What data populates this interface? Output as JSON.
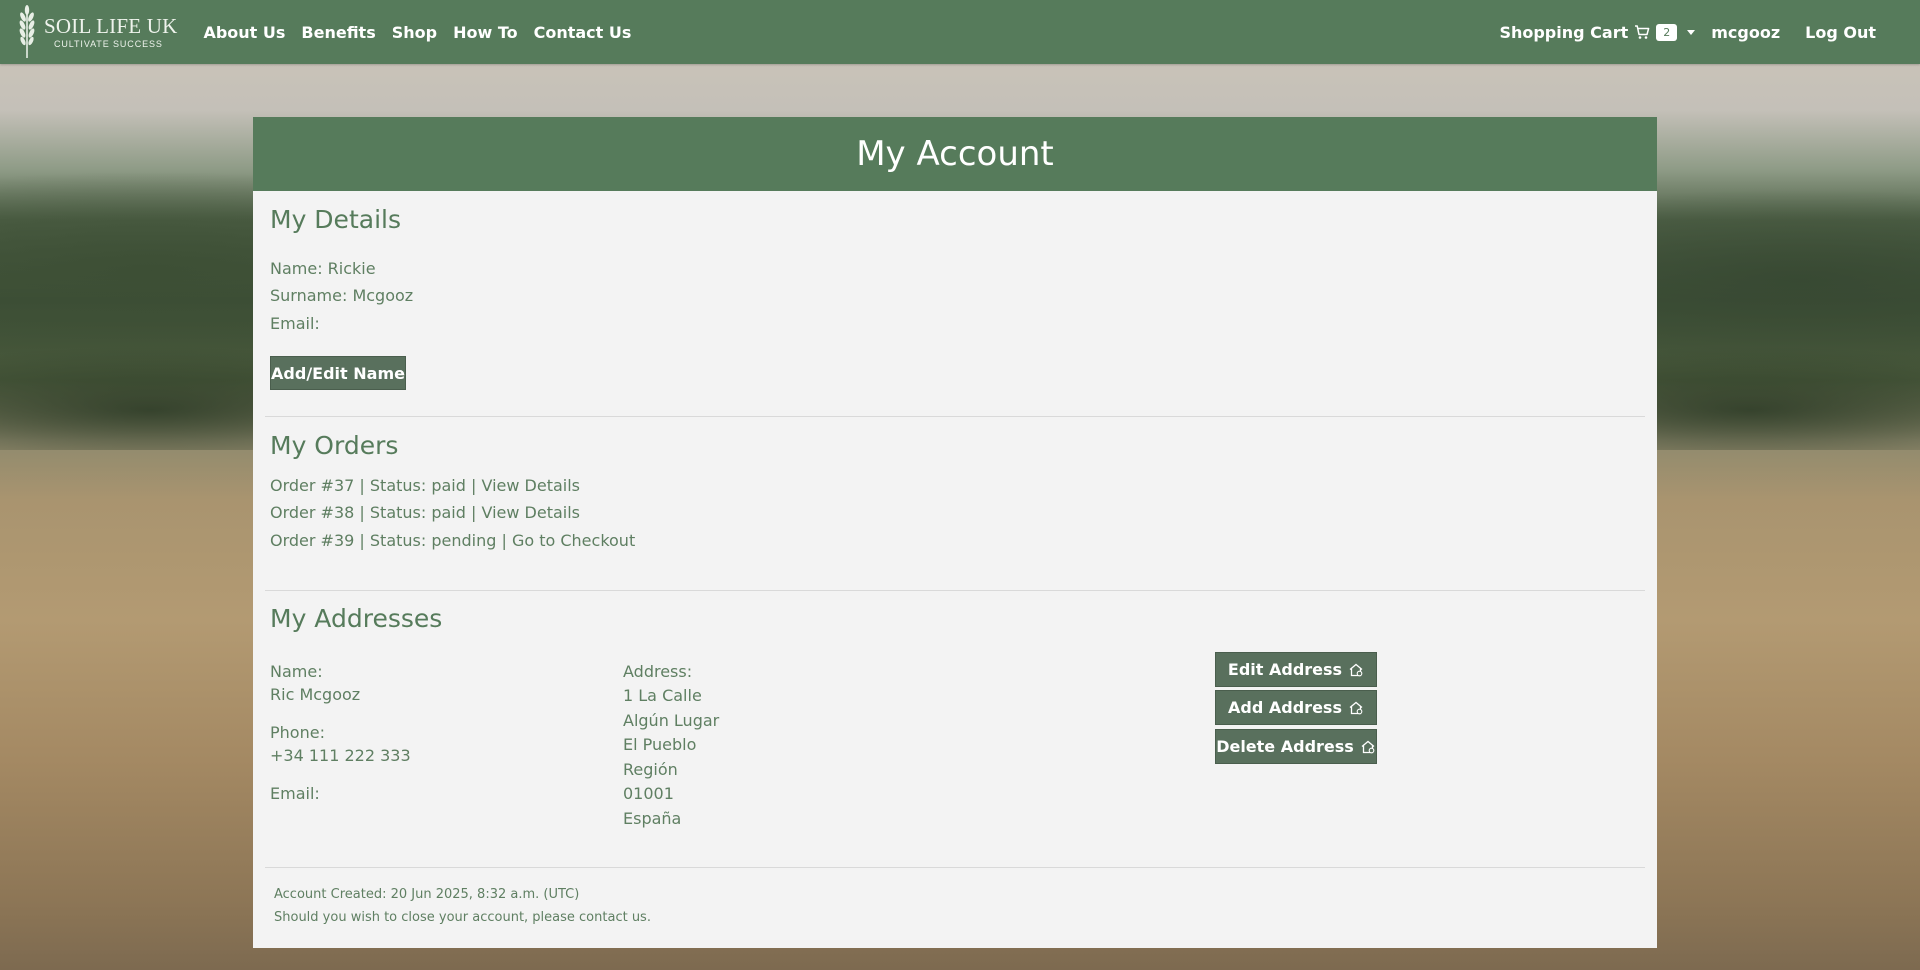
{
  "brand": {
    "name": "SOIL LIFE UK",
    "tagline": "CULTIVATE SUCCESS"
  },
  "nav": {
    "links": [
      "About Us",
      "Benefits",
      "Shop",
      "How To",
      "Contact Us"
    ],
    "cart_label": "Shopping Cart",
    "cart_count": "2",
    "username": "mcgooz",
    "logout": "Log Out"
  },
  "page": {
    "title": "My Account"
  },
  "details": {
    "title": "My Details",
    "name": "Name: Rickie",
    "surname": "Surname: Mcgooz",
    "email": "Email:",
    "edit_button": "Add/Edit Name"
  },
  "orders": {
    "title": "My Orders",
    "items": [
      "Order #37 | Status: paid | View Details",
      "Order #38 | Status: paid | View Details",
      "Order #39 | Status: pending | Go to Checkout"
    ]
  },
  "addresses": {
    "title": "My Addresses",
    "name_label": "Name:",
    "name_value": "Ric Mcgooz",
    "phone_label": "Phone:",
    "phone_value": "+34 111 222 333",
    "email_label": "Email:",
    "address_label": "Address:",
    "address_lines": [
      "1 La Calle",
      "Algún Lugar",
      "El Pueblo",
      "Región",
      "01001",
      "España"
    ],
    "buttons": {
      "edit": "Edit Address",
      "add": "Add Address",
      "delete": "Delete Address"
    }
  },
  "footer": {
    "created": "Account Created: 20 Jun 2025, 8:32 a.m. (UTC)",
    "close_note": "Should you wish to close your account, please contact us."
  },
  "colors": {
    "brand_green": "#567b5b",
    "button": "#59705d",
    "card_bg": "#f3f3f3",
    "text_green": "#5f7f62"
  },
  "icons": {
    "cart": "cart-icon",
    "address": "house-icon",
    "logo": "wheat-logo-icon"
  }
}
